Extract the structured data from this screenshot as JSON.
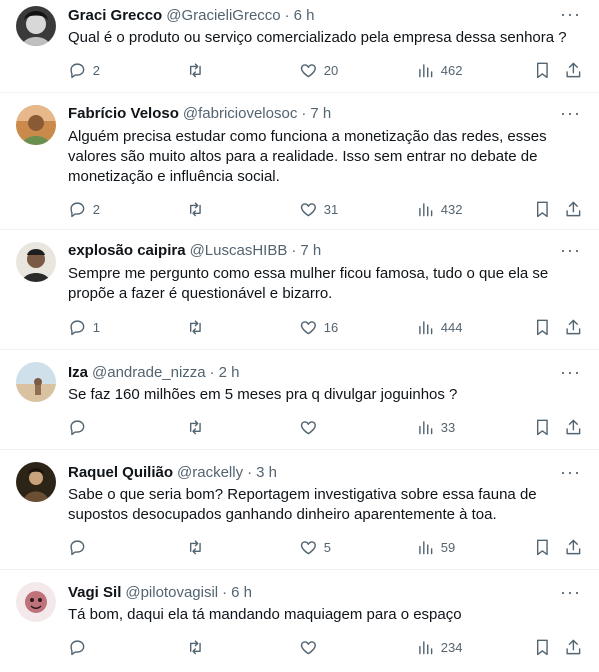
{
  "tweets": [
    {
      "name": "Graci Grecco",
      "handle": "@GracieliGrecco",
      "time": "6 h",
      "text": "Qual é o produto ou serviço comercializado pela empresa dessa senhora ?",
      "replies": "2",
      "retweets": "",
      "likes": "20",
      "views": "462"
    },
    {
      "name": "Fabrício Veloso",
      "handle": "@fabriciovelosoc",
      "time": "7 h",
      "text": "Alguém precisa estudar como funciona a monetização das redes, esses valores são muito altos para a realidade. Isso sem entrar no debate de monetização e influência social.",
      "replies": "2",
      "retweets": "",
      "likes": "31",
      "views": "432"
    },
    {
      "name": "explosão caipira",
      "handle": "@LuscasHIBB",
      "time": "7 h",
      "text": "Sempre me pergunto como essa mulher ficou famosa, tudo o que ela se propõe a fazer é questionável e bizarro.",
      "replies": "1",
      "retweets": "",
      "likes": "16",
      "views": "444"
    },
    {
      "name": "Iza",
      "handle": "@andrade_nizza",
      "time": "2 h",
      "text": "Se faz 160 milhões em 5 meses pra q divulgar joguinhos ?",
      "replies": "",
      "retweets": "",
      "likes": "",
      "views": "33"
    },
    {
      "name": "Raquel Quilião",
      "handle": "@rackelly",
      "time": "3 h",
      "text": "Sabe o que seria bom? Reportagem investigativa sobre essa fauna de supostos desocupados ganhando dinheiro aparentemente à toa.",
      "replies": "",
      "retweets": "",
      "likes": "5",
      "views": "59"
    },
    {
      "name": "Vagi Sil",
      "handle": "@pilotovagisil",
      "time": "6 h",
      "text": "Tá bom, daqui ela tá mandando maquiagem para o espaço",
      "replies": "",
      "retweets": "",
      "likes": "",
      "views": "234"
    }
  ],
  "separator": "·",
  "more_glyph": "···",
  "colors": {
    "text": "#0f1419",
    "secondary": "#536471",
    "border": "#eff3f4"
  }
}
